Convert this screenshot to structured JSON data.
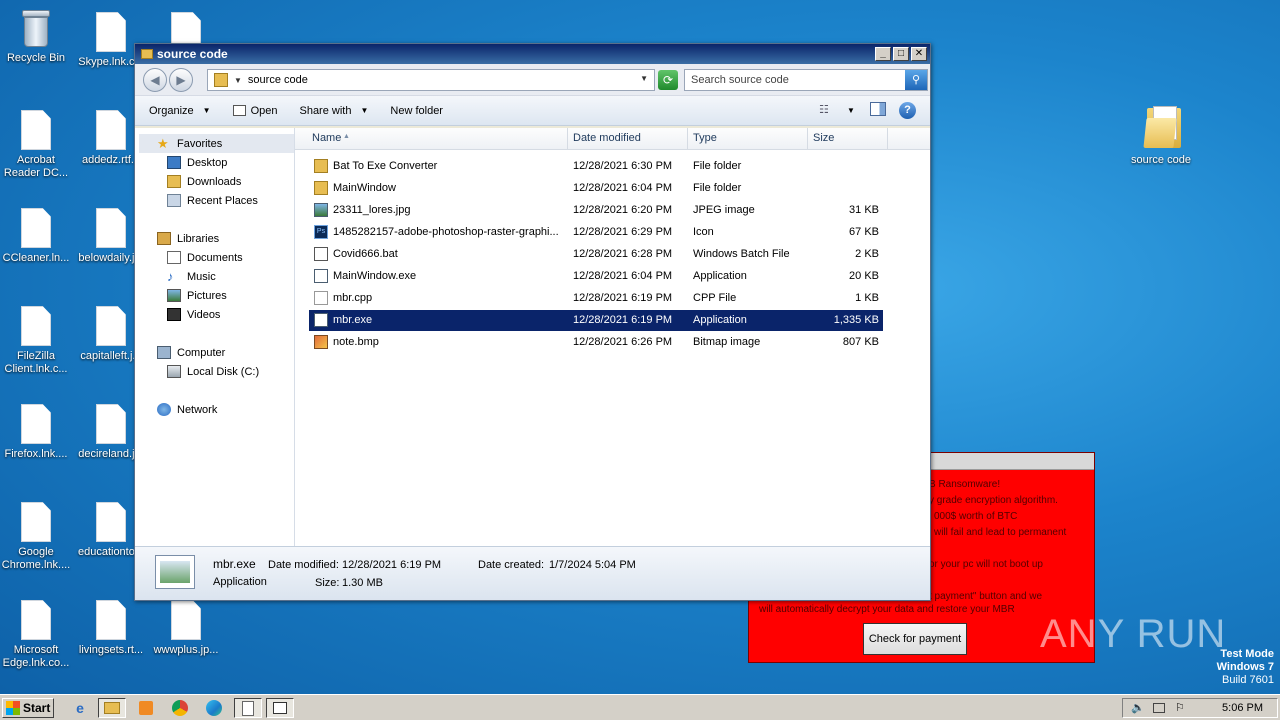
{
  "desktop": {
    "icons": [
      {
        "label": "Recycle Bin",
        "type": "bin"
      },
      {
        "label": "Skype.lnk.c...",
        "type": "doc"
      },
      {
        "label": "",
        "type": "doc"
      },
      {
        "label": "Acrobat Reader DC...",
        "type": "doc"
      },
      {
        "label": "addedz.rtf...",
        "type": "doc"
      },
      {
        "label": "CCleaner.ln...",
        "type": "doc"
      },
      {
        "label": "belowdaily.j...",
        "type": "doc"
      },
      {
        "label": "FileZilla Client.lnk.c...",
        "type": "doc"
      },
      {
        "label": "capitalleft.j...",
        "type": "doc"
      },
      {
        "label": "Firefox.lnk....",
        "type": "doc"
      },
      {
        "label": "decireland.j...",
        "type": "doc"
      },
      {
        "label": "Google Chrome.lnk....",
        "type": "doc"
      },
      {
        "label": "educationto...",
        "type": "doc"
      },
      {
        "label": "Microsoft Edge.lnk.co...",
        "type": "doc"
      },
      {
        "label": "livingsets.rt...",
        "type": "doc"
      },
      {
        "label": "wwwplus.jp...",
        "type": "doc"
      },
      {
        "label": "source code",
        "type": "folder"
      }
    ]
  },
  "ransom": {
    "lines": [
      "B Ransomware!",
      "y grade encryption algorithm.",
      "000$ worth of BTC",
      "will fail and lead to permanent",
      "",
      "or your pc will not boot up",
      "",
      "t payment\" button and we",
      "will automatically decrypt your data and restore your MBR"
    ],
    "button_label": "Check for payment"
  },
  "explorer": {
    "title": "source code",
    "address": "source code",
    "search_placeholder": "Search source code",
    "toolbar": {
      "organize": "Organize",
      "open": "Open",
      "share_with": "Share with",
      "new_folder": "New folder"
    },
    "nav": {
      "favorites": "Favorites",
      "desktop": "Desktop",
      "downloads": "Downloads",
      "recent_places": "Recent Places",
      "libraries": "Libraries",
      "documents": "Documents",
      "music": "Music",
      "pictures": "Pictures",
      "videos": "Videos",
      "computer": "Computer",
      "local_disk": "Local Disk (C:)",
      "network": "Network"
    },
    "columns": {
      "name": "Name",
      "date_modified": "Date modified",
      "type": "Type",
      "size": "Size"
    },
    "files": [
      {
        "name": "Bat To Exe Converter",
        "date": "12/28/2021 6:30 PM",
        "type": "File folder",
        "size": "",
        "icon": "folder"
      },
      {
        "name": "MainWindow",
        "date": "12/28/2021 6:04 PM",
        "type": "File folder",
        "size": "",
        "icon": "folder"
      },
      {
        "name": "23311_lores.jpg",
        "date": "12/28/2021 6:20 PM",
        "type": "JPEG image",
        "size": "31 KB",
        "icon": "image"
      },
      {
        "name": "1485282157-adobe-photoshop-raster-graphi...",
        "date": "12/28/2021 6:29 PM",
        "type": "Icon",
        "size": "67 KB",
        "icon": "ps"
      },
      {
        "name": "Covid666.bat",
        "date": "12/28/2021 6:28 PM",
        "type": "Windows Batch File",
        "size": "2 KB",
        "icon": "bat"
      },
      {
        "name": "MainWindow.exe",
        "date": "12/28/2021 6:04 PM",
        "type": "Application",
        "size": "20 KB",
        "icon": "exe"
      },
      {
        "name": "mbr.cpp",
        "date": "12/28/2021 6:19 PM",
        "type": "CPP File",
        "size": "1 KB",
        "icon": "cpp"
      },
      {
        "name": "mbr.exe",
        "date": "12/28/2021 6:19 PM",
        "type": "Application",
        "size": "1,335 KB",
        "icon": "exe",
        "selected": true
      },
      {
        "name": "note.bmp",
        "date": "12/28/2021 6:26 PM",
        "type": "Bitmap image",
        "size": "807 KB",
        "icon": "bmp"
      }
    ],
    "details": {
      "name": "mbr.exe",
      "type": "Application",
      "date_modified_label": "Date modified:",
      "date_modified": "12/28/2021 6:19 PM",
      "date_created_label": "Date created:",
      "date_created": "1/7/2024 5:04 PM",
      "size_label": "Size:",
      "size": "1.30 MB"
    }
  },
  "taskbar": {
    "start_label": "Start",
    "clock": "5:06 PM"
  },
  "watermark": {
    "line1": "Test Mode",
    "line2": "Windows 7",
    "line3": "Build 7601",
    "brand": "ANY RUN"
  },
  "colors": {
    "selection": "#0a246a",
    "ransom_red": "#ff0000",
    "desktop_blue": "#1c84cc"
  }
}
